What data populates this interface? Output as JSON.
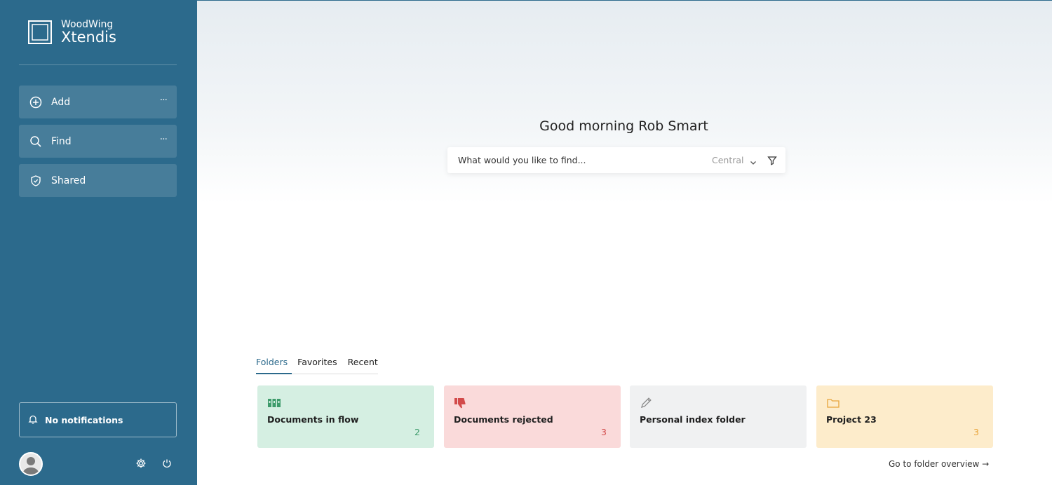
{
  "brand": {
    "top": "WoodWing",
    "bottom": "Xtendis"
  },
  "sidebar": {
    "items": [
      {
        "label": "Add",
        "more": "···"
      },
      {
        "label": "Find",
        "more": "···"
      },
      {
        "label": "Shared"
      }
    ],
    "notifications": "No notifications"
  },
  "main": {
    "greeting": "Good morning Rob Smart",
    "search": {
      "placeholder": "What would you like to find...",
      "scope": "Central"
    },
    "tabs": [
      "Folders",
      "Favorites",
      "Recent"
    ],
    "cards": [
      {
        "title": "Documents in flow",
        "count": "2",
        "bg": "#d5efe2",
        "count_color": "#3d9b6b"
      },
      {
        "title": "Documents rejected",
        "count": "3",
        "bg": "#fadada",
        "count_color": "#d24a4a"
      },
      {
        "title": "Personal index folder",
        "count": "",
        "bg": "#f0f1f2",
        "count_color": "#333333"
      },
      {
        "title": "Project 23",
        "count": "3",
        "bg": "#fdeccb",
        "count_color": "#e8a43a"
      }
    ],
    "overview_link": "Go to folder overview →"
  },
  "colors": {
    "sidebar": "#2c6a8c",
    "accent": "#2c6a8c"
  },
  "icons": [
    "add-circle-icon",
    "search-icon",
    "shield-icon",
    "bell-icon",
    "gear-icon",
    "power-icon",
    "filter-icon",
    "chevron-down-icon",
    "binders-icon",
    "thumbs-down-icon",
    "pencil-icon",
    "folder-icon"
  ]
}
